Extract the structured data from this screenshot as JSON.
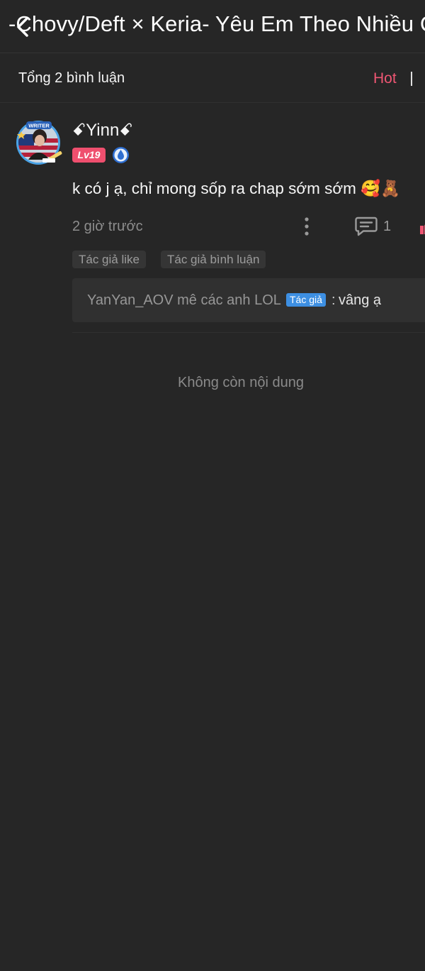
{
  "header": {
    "title": "-Chovy/Deft × Keria- Yêu Em Theo Nhiều C",
    "back_icon": "chevron-left-icon"
  },
  "comments_header": {
    "total_label": "Tổng 2 bình luận",
    "sort_hot_label": "Hot",
    "accent_color": "#ef5673"
  },
  "comment": {
    "avatar_icon": "writer-avatar",
    "username": "ꗃYinnꗃ",
    "level_label": "Lv19",
    "member_icon": "water-drop-badge-icon",
    "text": "k có j ạ, chỉ mong sốp ra chap sớm sớm 🥰🧸",
    "timestamp": "2 giờ trước",
    "reply_count": "1",
    "tags": [
      "Tác giả like",
      "Tác giả bình luận"
    ],
    "reply": {
      "author": "YanYan_AOV mê các anh LOL",
      "author_badge": "Tác giả",
      "separator": ":",
      "text": "vâng ạ"
    }
  },
  "footer": {
    "end_message": "Không còn nội dung"
  }
}
